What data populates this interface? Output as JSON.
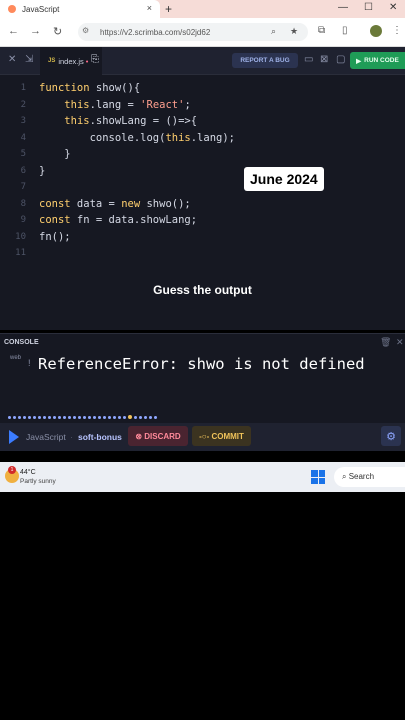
{
  "browser": {
    "tab_title": "JavaScript",
    "tab_close": "×",
    "new_tab": "+",
    "url": "https://v2.scrimba.com/s02jd62",
    "minimize": "—",
    "maximize": "☐",
    "close": "✕",
    "back": "←",
    "forward": "→",
    "reload": "↻",
    "omni_icon": "⚙",
    "zoom_icon": "⌕",
    "star_icon": "★",
    "ext_icon": "⧉",
    "sidepanel_icon": "▯",
    "menu_icon": "⋮"
  },
  "toolbar": {
    "file_name": "index.js",
    "file_badge": "JS",
    "modified_dot": "•",
    "report_label": "REPORT A BUG",
    "run_label": "RUN CODE",
    "close_icon": "✕",
    "collapse_icon": "⇲",
    "newfile_icon": "⎘",
    "layout_icons": [
      "▭",
      "⊠",
      "▢"
    ]
  },
  "code": {
    "lines": [
      {
        "n": "1",
        "text": "function show(){"
      },
      {
        "n": "2",
        "text": "    this.lang = 'React';"
      },
      {
        "n": "3",
        "text": "    this.showLang = ()=>{"
      },
      {
        "n": "4",
        "text": "        console.log(this.lang);"
      },
      {
        "n": "5",
        "text": "    }"
      },
      {
        "n": "6",
        "text": "}"
      },
      {
        "n": "7",
        "text": ""
      },
      {
        "n": "8",
        "text": "const data = new shwo();"
      },
      {
        "n": "9",
        "text": "const fn = data.showLang;"
      },
      {
        "n": "10",
        "text": "fn();"
      },
      {
        "n": "11",
        "text": ""
      }
    ]
  },
  "overlay": {
    "date_badge": "June 2024",
    "caption": "Guess the output"
  },
  "console": {
    "title": "CONSOLE",
    "clear_icon": "🗑",
    "close_icon": "✕",
    "source_label": "web",
    "error_marker": "!",
    "error_text": "ReferenceError: shwo is not defined"
  },
  "bottombar": {
    "language": "JavaScript",
    "separator": "·",
    "branch": "soft-bonus",
    "discard_label": "⊗ DISCARD",
    "commit_label": "-○- COMMIT",
    "settings_icon": "⚙"
  },
  "taskbar": {
    "temperature": "44°C",
    "condition": "Partly sunny",
    "weather_badge": "1",
    "search_label": "⌕  Search"
  }
}
